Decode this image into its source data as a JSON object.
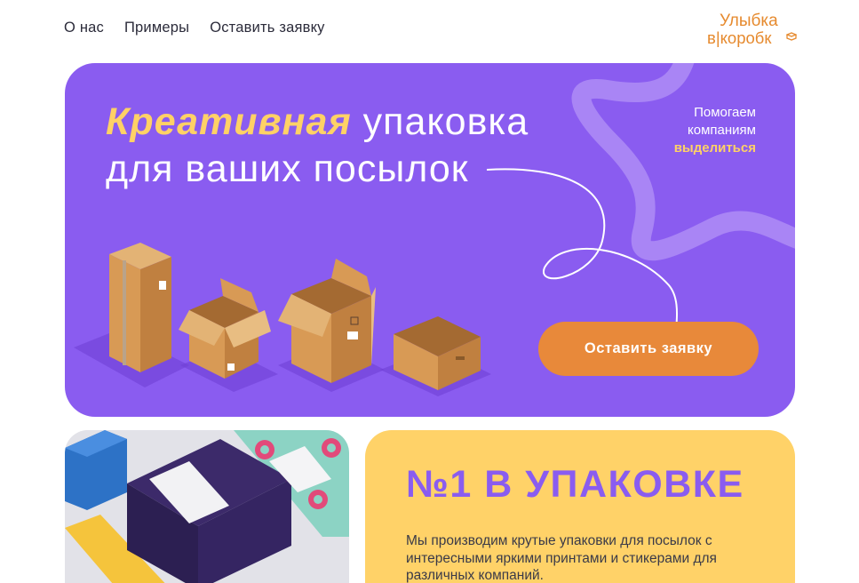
{
  "nav": {
    "items": [
      {
        "label": "О нас"
      },
      {
        "label": "Примеры"
      },
      {
        "label": "Оставить заявку"
      }
    ]
  },
  "logo": {
    "line1": "Улыбка",
    "line2": "в|коробк",
    "icon": "box-icon",
    "color": "#e68a2e"
  },
  "hero": {
    "title_accent": "Креативная",
    "title_rest": " упаковка",
    "title_line2": "для ваших посылок",
    "tagline_line1": "Помогаем",
    "tagline_line2": "компаниям",
    "tagline_highlight": "выделиться",
    "cta_label": "Оставить заявку",
    "background": "#8a5cf0",
    "accent_color": "#ffd166",
    "cta_color": "#e8893a"
  },
  "feature": {
    "title": "№1 В УПАКОВКЕ",
    "text": "Мы производим крутые упаковки для посылок с интересными яркими принтами и стикерами для различных компаний.",
    "background": "#ffd268",
    "title_color": "#8a5cf0"
  },
  "photo": {
    "description_icon": "packaging-photo"
  }
}
